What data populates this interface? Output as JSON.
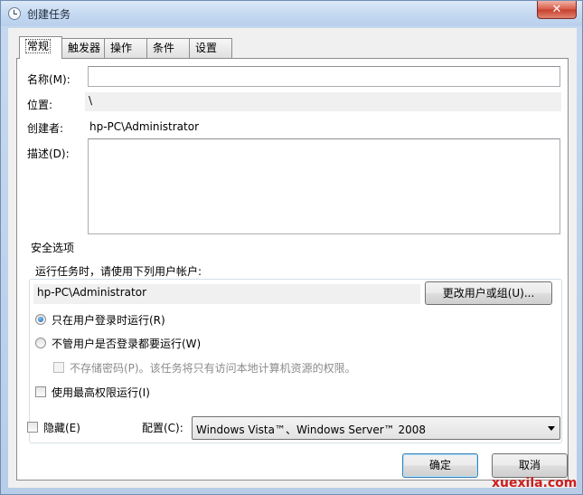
{
  "window": {
    "title": "创建任务",
    "close_label": "✕"
  },
  "tabs": [
    "常规",
    "触发器",
    "操作",
    "条件",
    "设置"
  ],
  "general": {
    "name_label": "名称(M):",
    "name_value": "",
    "location_label": "位置:",
    "location_value": "\\",
    "author_label": "创建者:",
    "author_value": "hp-PC\\Administrator",
    "description_label": "描述(D):",
    "description_value": ""
  },
  "security": {
    "title": "安全选项",
    "run_as_prompt": "运行任务时，请使用下列用户帐户:",
    "user_account": "hp-PC\\Administrator",
    "change_user_button": "更改用户或组(U)...",
    "radio_logged_on_only": "只在用户登录时运行(R)",
    "radio_logged_on_only_selected": true,
    "radio_whether_logged_on": "不管用户是否登录都要运行(W)",
    "radio_whether_logged_on_selected": false,
    "no_store_password": "不存储密码(P)。该任务将只有访问本地计算机资源的权限。",
    "no_store_password_checked": false,
    "highest_privileges": "使用最高权限运行(I)",
    "highest_privileges_checked": false
  },
  "footer": {
    "hidden_label": "隐藏(E)",
    "hidden_checked": false,
    "configure_label": "配置(C):",
    "configure_value": "Windows Vista™、Windows Server™ 2008",
    "ok_button": "确定",
    "cancel_button": "取消"
  },
  "watermark": "xuexila.com",
  "colors": {
    "close_button": "#c5412f",
    "titlebar": "#c4d8f0",
    "watermark": "#cc1f1f"
  }
}
